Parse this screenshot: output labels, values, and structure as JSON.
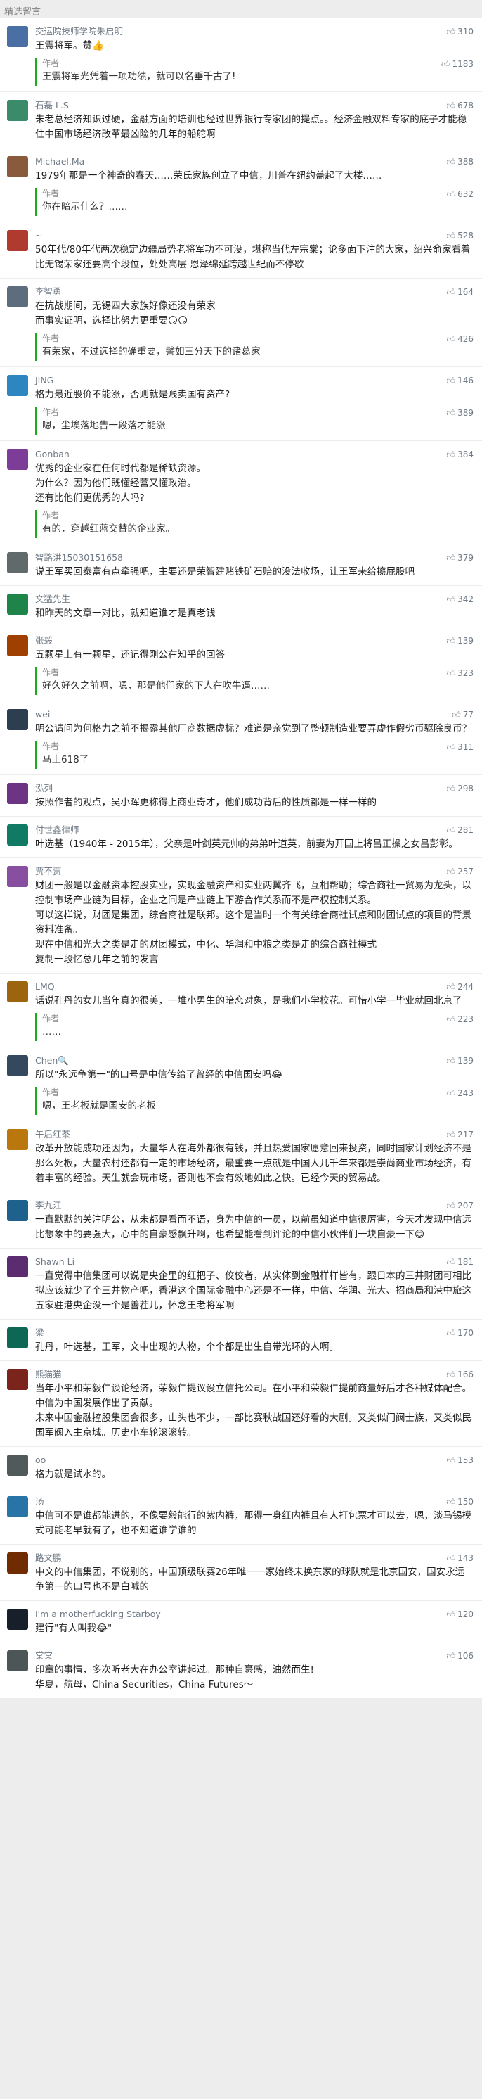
{
  "header": {
    "title": "精选留言"
  },
  "comments": [
    {
      "name": "交运院技师学院朱启明",
      "likes": "310",
      "text": "王震将军。赞👍",
      "reply_label": "作者",
      "reply": "王震将军光凭着一项功绩，就可以名垂千古了!",
      "reply_likes": "1183"
    },
    {
      "name": "石磊 L.S",
      "likes": "678",
      "text": "朱老总经济知识过硬，金融方面的培训也经过世界银行专家团的提点。。经济金融双料专家的底子才能稳住中国市场经济改革最凶险的几年的船舵啊"
    },
    {
      "name": "Michael.Ma",
      "likes": "388",
      "text": "1979年那是一个神奇的春天……荣氏家族创立了中信，川普在纽约盖起了大楼……",
      "reply_label": "作者",
      "reply": "你在暗示什么？……",
      "reply_likes": "632"
    },
    {
      "name": "~",
      "likes": "528",
      "text": "50年代/80年代两次稳定边疆局势老将军功不可没，堪称当代左宗棠；论多面下注的大家，绍兴俞家看着比无锡荣家还要高个段位，处处高层 恩泽绵延跨越世纪而不停歇"
    },
    {
      "name": "李智勇",
      "likes": "164",
      "text": "在抗战期间，无锡四大家族好像还没有荣家\n而事实证明，选择比努力更重要😏😏",
      "reply_label": "作者",
      "reply": "有荣家，不过选择的确重要，譬如三分天下的诸葛家",
      "reply_likes": "426"
    },
    {
      "name": "JING",
      "likes": "146",
      "text": "格力最近股价不能涨，否则就是贱卖国有资产?",
      "reply_label": "作者",
      "reply": "嗯，尘埃落地告一段落才能涨",
      "reply_likes": "389"
    },
    {
      "name": "Gonban",
      "likes": "384",
      "text": "优秀的企业家在任何时代都是稀缺资源。\n为什么？因为他们既懂经营又懂政治。\n还有比他们更优秀的人吗?",
      "reply_label": "作者",
      "reply": "有的，穿越红蓝交替的企业家。",
      "reply_likes": ""
    },
    {
      "name": "智路洪15030151658",
      "likes": "379",
      "text": "说王军买回泰富有点牵强吧，主要还是荣智建赌铁矿石赔的没法收场，让王军来给擦屁股吧"
    },
    {
      "name": "文猛先生",
      "likes": "342",
      "text": "和昨天的文章一对比，就知道谁才是真老钱"
    },
    {
      "name": "张毅",
      "likes": "139",
      "text": "五颗星上有一颗星，还记得刚公在知乎的回答",
      "reply_label": "作者",
      "reply": "好久好久之前啊，嗯，那是他们家的下人在吹牛逼……",
      "reply_likes": "323"
    },
    {
      "name": "wei",
      "likes": "77",
      "text": "明公请问为何格力之前不揭露其他厂商数据虚标？难道是亲觉到了整顿制造业要弄虚作假劣币驱除良币？",
      "reply_label": "作者",
      "reply": "马上618了",
      "reply_likes": "311"
    },
    {
      "name": "泓列",
      "likes": "298",
      "text": "按照作者的观点，吴小晖更称得上商业奇才，他们成功背后的性质都是一样一样的"
    },
    {
      "name": "付世鑫律师",
      "likes": "281",
      "text": "叶选基（1940年 - 2015年），父亲是叶剑英元帅的弟弟叶道英，前妻为开国上将吕正操之女吕彭彰。"
    },
    {
      "name": "贾不贾",
      "likes": "257",
      "text": "财团一般是以金融资本控股实业，实现金融资产和实业两翼齐飞，互相帮助；综合商社一贸易为龙头，以控制市场产业链为目标，企业之间是产业链上下游合作关系而不是产权控制关系。\n可以这样说，财团是集团，综合商社是联邦。这个是当时一个有关综合商社试点和财团试点的项目的背景资料准备。\n现在中信和光大之类是走的财团模式，中化、华润和中粮之类是走的综合商社模式\n复制一段忆总几年之前的发言"
    },
    {
      "name": "LMQ",
      "likes": "244",
      "text": "话说孔丹的女儿当年真的很美，一堆小男生的暗恋对象，是我们小学校花。可惜小学一毕业就回北京了",
      "reply_label": "作者",
      "reply": "……",
      "reply_likes": "223"
    },
    {
      "name": "Chen🔍",
      "likes": "139",
      "text": "所以\"永远争第一\"的口号是中信传给了曾经的中信国安吗😂",
      "reply_label": "作者",
      "reply": "嗯，王老板就是国安的老板",
      "reply_likes": "243"
    },
    {
      "name": "午后红茶",
      "likes": "217",
      "text": "改革开放能成功还因为，大量华人在海外都很有钱，并且热爱国家愿意回来投资，同时国家计划经济不是那么死板，大量农村还都有一定的市场经济，最重要一点就是中国人几千年来都是崇尚商业市场经济，有着丰富的经验。天生就会玩市场，否则也不会有效地如此之快。已经今天的贸易战。"
    },
    {
      "name": "李九江",
      "likes": "207",
      "text": "一直默默的关注明公，从未都是看而不语，身为中信的一员，以前虽知道中信很厉害，今天才发现中信远比想象中的要强大，心中的自豪感飘升啊，也希望能看到评论的中信小伙伴们一块自豪一下😊"
    },
    {
      "name": "Shawn Li",
      "likes": "181",
      "text": "一直觉得中信集团可以说是央企里的红把子、佼佼者，从实体到金融样样皆有，跟日本的三井财团可相比拟应该就少了个三井物产吧，香港这个国际金融中心还是不一样，中信、华润、光大、招商局和港中旅这五家驻港央企没一个是善茬儿，怀念王老将军啊"
    },
    {
      "name": "梁",
      "likes": "170",
      "text": "孔丹，叶选基，王军，文中出现的人物，个个都是出生自带光环的人啊。"
    },
    {
      "name": "熊猫猫",
      "likes": "166",
      "text": "当年小平和荣毅仁谈论经济，荣毅仁提议设立信托公司。在小平和荣毅仁提前商量好后才各种媒体配合。\n中信为中国发展作出了贡献。\n未来中国金融控股集团会很多，山头也不少，一部比赛秋战国还好看的大剧。又类似门阀士族，又类似民国军阀入主京城。历史小车轮滚滚转。"
    },
    {
      "name": "oo",
      "likes": "153",
      "text": "格力就是试水的。"
    },
    {
      "name": "汤",
      "likes": "150",
      "text": "中信可不是谁都能进的，不像要毅能行的紫内裤，那得一身红内裤且有人打包票才可以去，嗯，淡马锡模式可能老早就有了，也不知道谁学谁的"
    },
    {
      "name": "路文鹏",
      "likes": "143",
      "text": "中文的中信集团，不说别的，中国顶级联赛26年唯一一家始终未换东家的球队就是北京国安，国安永远争第一的口号也不是白喊的"
    },
    {
      "name": "I'm a motherfucking Starboy",
      "likes": "120",
      "text": "建行\"有人叫我😂\""
    },
    {
      "name": "棠棠",
      "likes": "106",
      "text": "印章的事情，多次听老大在办公室讲起过。那种自豪感，油然而生!\n华夏，航母，China Securities，China Futures～"
    }
  ]
}
